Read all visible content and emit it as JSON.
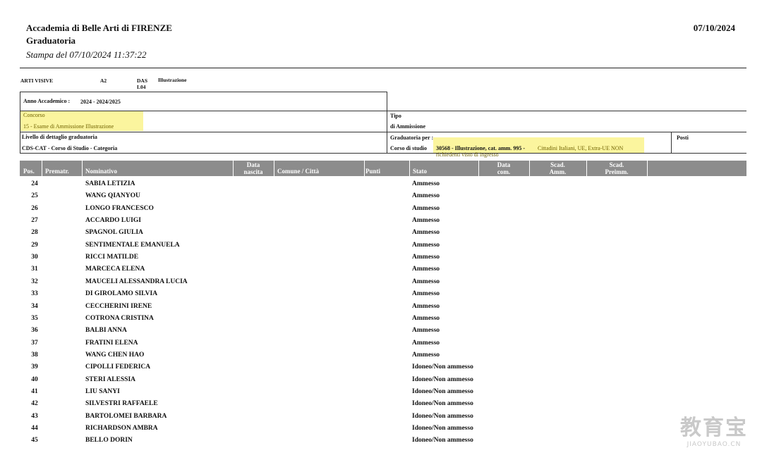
{
  "header": {
    "institution": "Accademia di Belle Arti di FIRENZE",
    "title": "Graduatoria",
    "printed": "Stampa del 07/10/2024 11:37:22",
    "date": "07/10/2024"
  },
  "info": {
    "area": "ARTI VISIVE",
    "level": "A2",
    "code_das": "DAS",
    "code_l": "L04",
    "subject": "Illustrazione",
    "anno_label": "Anno Accademico :",
    "anno_value": "2024  -  2024/2025",
    "concorso_label": "Concorso",
    "concorso_value": "15  -  Esame di Ammissione Illustrazione",
    "tipo_label": "Tipo",
    "tipo_value": "di Ammissione",
    "livello_label": "Livello di dettaglio graduatoria",
    "livello_value": "CDS-CAT  -  Corso di Studio - Categoria",
    "grad_label": "Graduatoria per :",
    "corso_label": "Corso di studio",
    "corso_value": "30568 - Illustrazione, cat. amm. 995 -",
    "category_value": "Cittadini Italiani, UE, Extra-UE NON",
    "category_value2": "richiedenti visto di ingresso",
    "posti_label": "Posti"
  },
  "table": {
    "columns": {
      "pos": "Pos.",
      "premat": "Prematr.",
      "nominativo": "Nominativo",
      "data_nascita_1": "Data",
      "data_nascita_2": "nascita",
      "comune": "Comune / Città",
      "punti": "Punti",
      "stato": "Stato",
      "data_com_1": "Data",
      "data_com_2": "com.",
      "scad_amm_1": "Scad.",
      "scad_amm_2": "Amm.",
      "scad_preimm_1": "Scad.",
      "scad_preimm_2": "Preimm."
    },
    "rows": [
      {
        "pos": "24",
        "name": "SABIA  LETIZIA",
        "stato": "Ammesso"
      },
      {
        "pos": "25",
        "name": "WANG  QIANYOU",
        "stato": "Ammesso"
      },
      {
        "pos": "26",
        "name": "LONGO  FRANCESCO",
        "stato": "Ammesso"
      },
      {
        "pos": "27",
        "name": "ACCARDO  LUIGI",
        "stato": "Ammesso"
      },
      {
        "pos": "28",
        "name": "SPAGNOL  GIULIA",
        "stato": "Ammesso"
      },
      {
        "pos": "29",
        "name": "SENTIMENTALE  EMANUELA",
        "stato": "Ammesso"
      },
      {
        "pos": "30",
        "name": "RICCI  MATILDE",
        "stato": "Ammesso"
      },
      {
        "pos": "31",
        "name": "MARCECA  ELENA",
        "stato": "Ammesso"
      },
      {
        "pos": "32",
        "name": "MAUCELI  ALESSANDRA LUCIA",
        "stato": "Ammesso"
      },
      {
        "pos": "33",
        "name": "DI GIROLAMO  SILVIA",
        "stato": "Ammesso"
      },
      {
        "pos": "34",
        "name": "CECCHERINI  IRENE",
        "stato": "Ammesso"
      },
      {
        "pos": "35",
        "name": "COTRONA  CRISTINA",
        "stato": "Ammesso"
      },
      {
        "pos": "36",
        "name": "BALBI  ANNA",
        "stato": "Ammesso"
      },
      {
        "pos": "37",
        "name": "FRATINI  ELENA",
        "stato": "Ammesso"
      },
      {
        "pos": "38",
        "name": "WANG  CHEN HAO",
        "stato": "Ammesso"
      },
      {
        "pos": "39",
        "name": "CIPOLLI  FEDERICA",
        "stato": "Idoneo/Non ammesso"
      },
      {
        "pos": "40",
        "name": "STERI  ALESSIA",
        "stato": "Idoneo/Non ammesso"
      },
      {
        "pos": "41",
        "name": "LIU  SANYI",
        "stato": "Idoneo/Non ammesso"
      },
      {
        "pos": "42",
        "name": "SILVESTRI  RAFFAELE",
        "stato": "Idoneo/Non ammesso"
      },
      {
        "pos": "43",
        "name": "BARTOLOMEI  BARBARA",
        "stato": "Idoneo/Non ammesso"
      },
      {
        "pos": "44",
        "name": "RICHARDSON  AMBRA",
        "stato": "Idoneo/Non ammesso"
      },
      {
        "pos": "45",
        "name": "BELLO  DORIN",
        "stato": "Idoneo/Non ammesso"
      }
    ]
  },
  "watermark": {
    "text": "教育宝",
    "url": "JIAOYUBAO.CN"
  },
  "colors": {
    "header_bg": "#8c8c8c",
    "highlight": "#fbf59e"
  }
}
